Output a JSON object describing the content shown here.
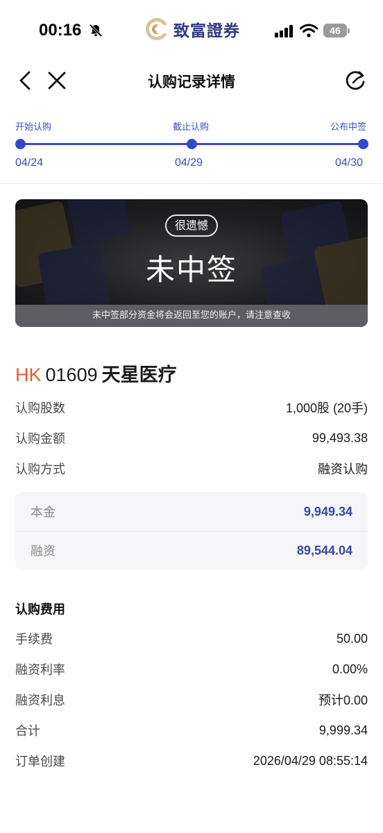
{
  "status_bar": {
    "time": "00:16",
    "brand": "致富證券",
    "battery": "46"
  },
  "nav": {
    "title": "认购记录详情"
  },
  "timeline": {
    "steps": [
      {
        "label": "开始认购",
        "date": "04/24"
      },
      {
        "label": "截止认购",
        "date": "04/29"
      },
      {
        "label": "公布中签",
        "date": "04/30"
      }
    ]
  },
  "result": {
    "badge": "很遗憾",
    "title": "未中签",
    "note": "未中签部分资金将会返回至您的账户，请注意查收"
  },
  "stock": {
    "market": "HK",
    "code": "01609",
    "name": "天星医疗"
  },
  "details": [
    {
      "label": "认购股数",
      "value": "1,000股 (20手)"
    },
    {
      "label": "认购金额",
      "value": "99,493.38"
    },
    {
      "label": "认购方式",
      "value": "融资认购"
    }
  ],
  "financing": [
    {
      "label": "本金",
      "value": "9,949.34"
    },
    {
      "label": "融资",
      "value": "89,544.04"
    }
  ],
  "fees": {
    "title": "认购费用",
    "rows": [
      {
        "label": "手续费",
        "value": "50.00"
      },
      {
        "label": "融资利率",
        "value": "0.00%"
      },
      {
        "label": "融资利息",
        "value": "预计0.00"
      },
      {
        "label": "合计",
        "value": "9,999.34"
      },
      {
        "label": "订单创建",
        "value": "2026/04/29 08:55:14"
      }
    ]
  },
  "colors": {
    "accent": "#3549c8",
    "market": "#e85b30",
    "amount": "#3a46a8"
  }
}
